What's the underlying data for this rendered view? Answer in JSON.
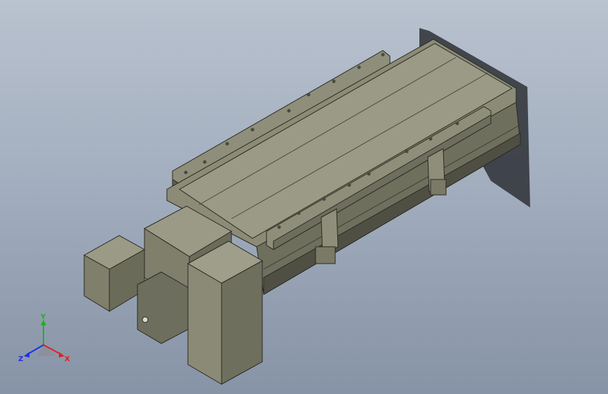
{
  "triad": {
    "x_label": "X",
    "y_label": "Y",
    "z_label": "Z",
    "x_color": "#e02020",
    "y_color": "#20b020",
    "z_color": "#2030e0"
  },
  "colors": {
    "background_top": "#b9c2cf",
    "background_bottom": "#8793a6",
    "body_light": "#9a9a86",
    "body_mid": "#7f7f6c",
    "body_dark": "#565648",
    "edge": "#2a2a22"
  }
}
